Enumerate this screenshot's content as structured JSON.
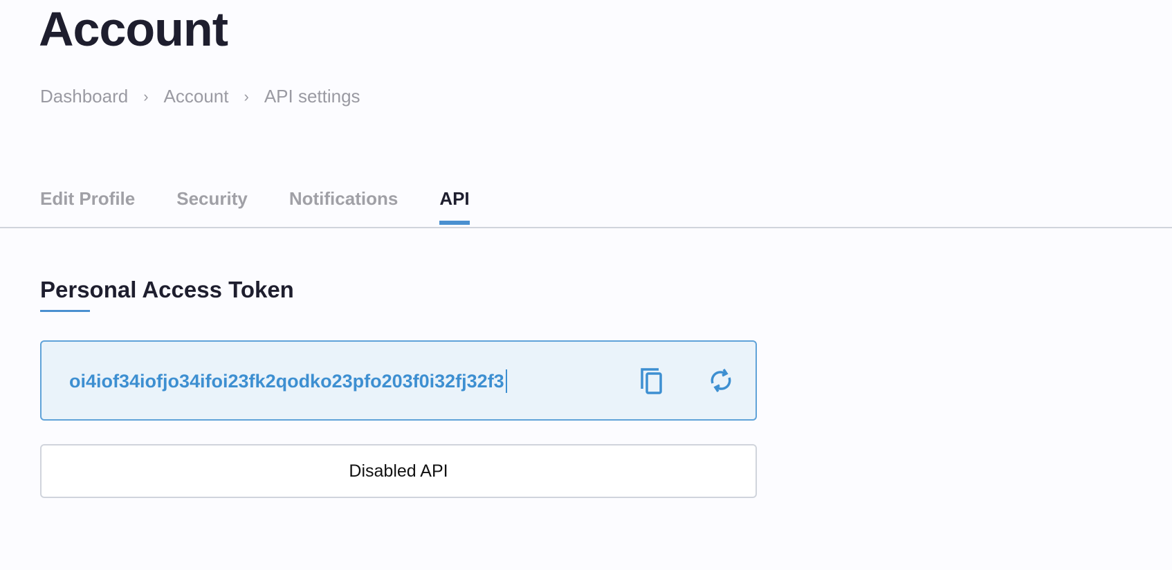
{
  "page": {
    "title": "Account"
  },
  "breadcrumb": [
    {
      "label": "Dashboard"
    },
    {
      "label": "Account"
    },
    {
      "label": "API settings"
    }
  ],
  "breadcrumb_separator": "›",
  "tabs": [
    {
      "label": "Edit Profile",
      "active": false
    },
    {
      "label": "Security",
      "active": false
    },
    {
      "label": "Notifications",
      "active": false
    },
    {
      "label": "API",
      "active": true
    }
  ],
  "section": {
    "heading": "Personal Access Token",
    "token_value": "oi4iof34iofjo34ifoi23fk2qodko23pfo203f0i32fj32f3",
    "copy_icon": "copy-icon",
    "refresh_icon": "refresh-icon",
    "disable_button": "Disabled API"
  },
  "colors": {
    "accent": "#4a90d0",
    "text": "#1e1e2e",
    "muted": "#9a9aa2"
  }
}
